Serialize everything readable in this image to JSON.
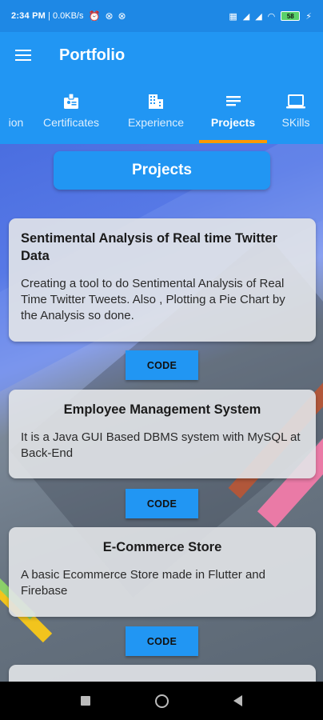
{
  "status_bar": {
    "time": "2:34 PM",
    "network_speed": "0.0KB/s",
    "battery": "58"
  },
  "app_bar": {
    "title": "Portfolio"
  },
  "tabs": [
    {
      "label": "ion",
      "icon": "person-icon",
      "active": false
    },
    {
      "label": "Certificates",
      "icon": "badge-icon",
      "active": false
    },
    {
      "label": "Experience",
      "icon": "building-icon",
      "active": false
    },
    {
      "label": "Projects",
      "icon": "list-icon",
      "active": true
    },
    {
      "label": "SKills",
      "icon": "laptop-icon",
      "active": false
    }
  ],
  "section": {
    "title": "Projects"
  },
  "projects": [
    {
      "title": "Sentimental Analysis of Real time Twitter Data",
      "description": "Creating a tool to do Sentimental Analysis of Real Time Twitter Tweets. Also , Plotting a Pie Chart by the Analysis so done.",
      "button": "CODE"
    },
    {
      "title": "Employee Management System",
      "description": "It is a Java GUI Based DBMS system with MySQL at Back-End",
      "button": "CODE"
    },
    {
      "title": "E-Commerce Store",
      "description": "A basic Ecommerce Store made in Flutter and Firebase",
      "button": "CODE"
    }
  ],
  "colors": {
    "primary": "#2196f3",
    "status_bar": "#1e88e5",
    "tab_indicator": "#ff9800"
  }
}
